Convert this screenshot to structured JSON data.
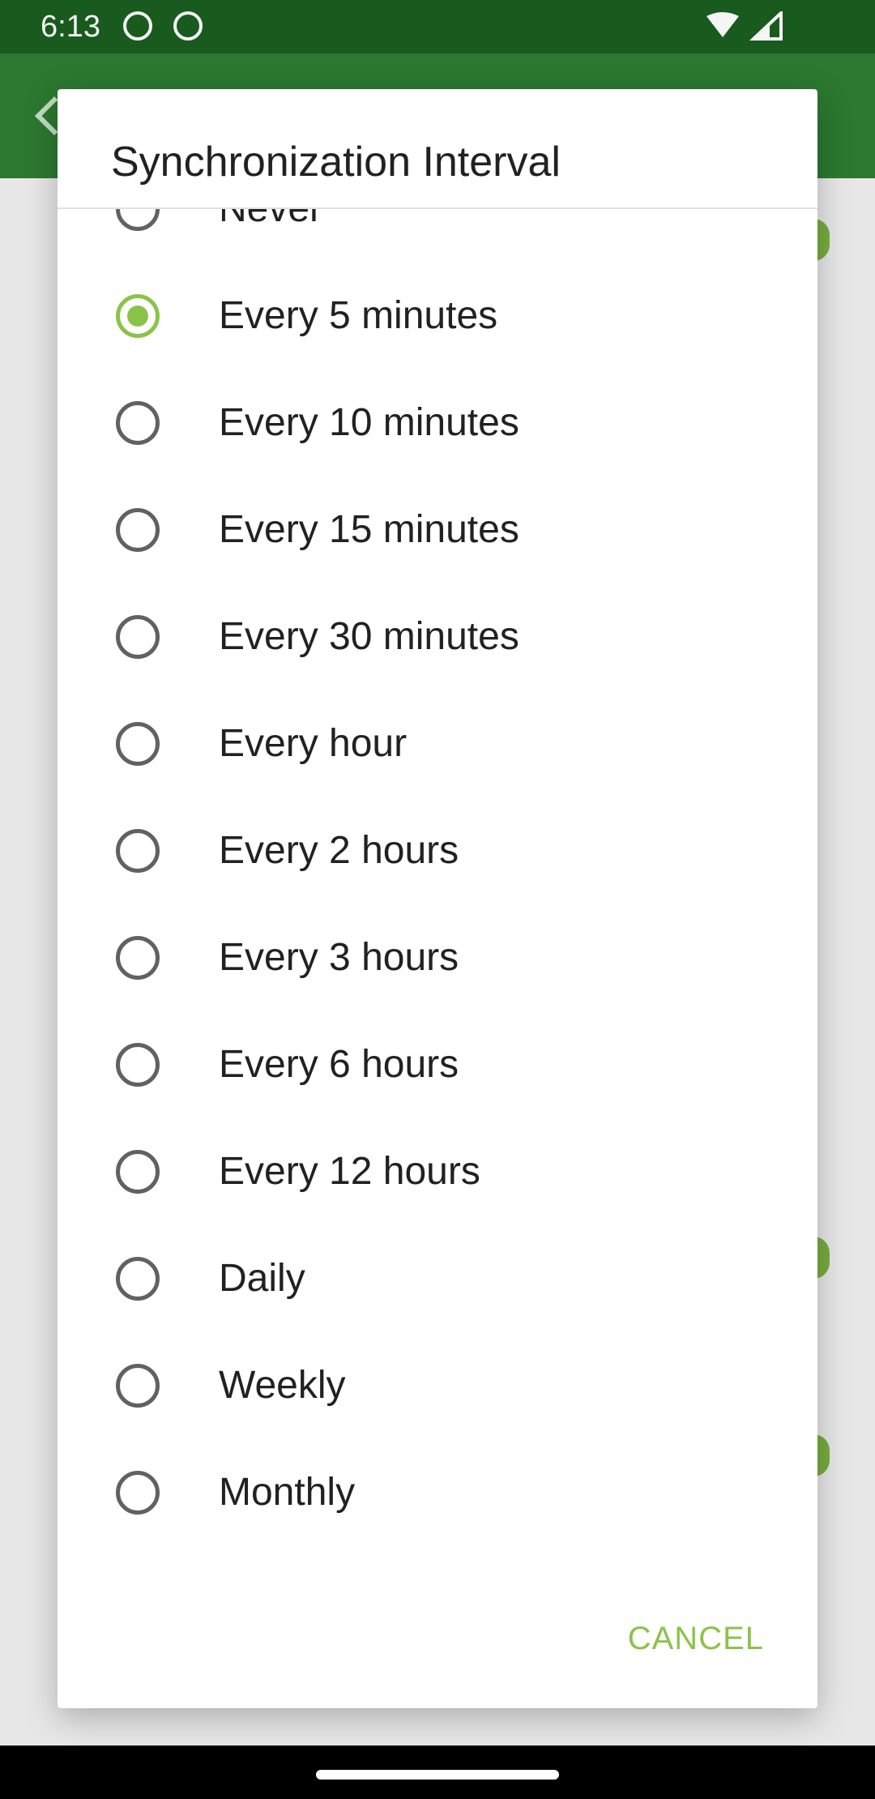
{
  "status_bar": {
    "time": "6:13"
  },
  "dialog": {
    "title": "Synchronization Interval",
    "selected_index": 1,
    "options": [
      {
        "label": "Never"
      },
      {
        "label": "Every 5 minutes"
      },
      {
        "label": "Every 10 minutes"
      },
      {
        "label": "Every 15 minutes"
      },
      {
        "label": "Every 30 minutes"
      },
      {
        "label": "Every hour"
      },
      {
        "label": "Every 2 hours"
      },
      {
        "label": "Every 3 hours"
      },
      {
        "label": "Every 6 hours"
      },
      {
        "label": "Every 12 hours"
      },
      {
        "label": "Daily"
      },
      {
        "label": "Weekly"
      },
      {
        "label": "Monthly"
      }
    ],
    "cancel_label": "CANCEL"
  },
  "colors": {
    "accent": "#8bc34a",
    "status_bar": "#1b5e20",
    "app_bar": "#2e7d32"
  }
}
